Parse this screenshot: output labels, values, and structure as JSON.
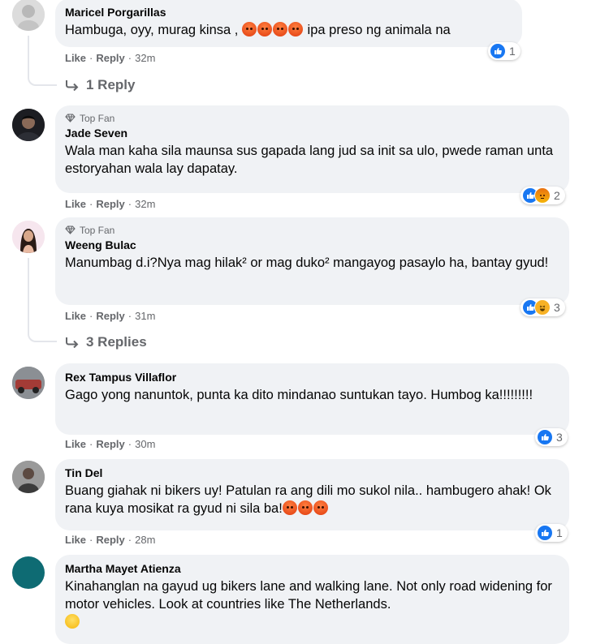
{
  "ui": {
    "like": "Like",
    "reply": "Reply",
    "separator": "·",
    "top_fan": "Top Fan"
  },
  "comments": [
    {
      "author": "Maricel Porgarillas",
      "text_before": "Hambuga, oyy, murag kinsa ,",
      "text_after": " ipa preso ng animala na",
      "time": "32m",
      "reaction_count": "1",
      "reactions": [
        "like"
      ],
      "replies": "1 Reply"
    },
    {
      "top_fan": true,
      "author": "Jade Seven",
      "text": "Wala man kaha sila maunsa sus gapada lang jud sa init sa ulo, pwede raman unta estoryahan wala lay dapatay.",
      "time": "32m",
      "reaction_count": "2",
      "reactions": [
        "like",
        "angry"
      ]
    },
    {
      "top_fan": true,
      "author": "Weeng Bulac",
      "text": "Manumbag d.i?Nya mag hilak² or mag duko² mangayog pasaylo ha, bantay gyud!",
      "time": "31m",
      "reaction_count": "3",
      "reactions": [
        "like",
        "haha"
      ],
      "replies": "3 Replies"
    },
    {
      "author": "Rex Tampus Villaflor",
      "text": "Gago yong nanuntok, punta ka dito mindanao suntukan tayo. Humbog ka!!!!!!!!!",
      "time": "30m",
      "reaction_count": "3",
      "reactions": [
        "like"
      ]
    },
    {
      "author": "Tin Del",
      "text": "Buang giahak ni bikers uy! Patulan ra ang dili mo sukol nila.. hambugero ahak! Ok rana kuya mosikat ra gyud ni sila ba!",
      "time": "28m",
      "reaction_count": "1",
      "reactions": [
        "like"
      ]
    },
    {
      "author": "Martha Mayet Atienza",
      "text": "Kinahanglan na gayud ug bikers lane and walking lane. Not only road widening for motor vehicles. Look at countries like The Netherlands."
    }
  ],
  "colors": {
    "bubble": "#f0f2f5",
    "like_blue": "#1877f2",
    "muted": "#65676b",
    "avatar_teal": "#0e6b73"
  }
}
